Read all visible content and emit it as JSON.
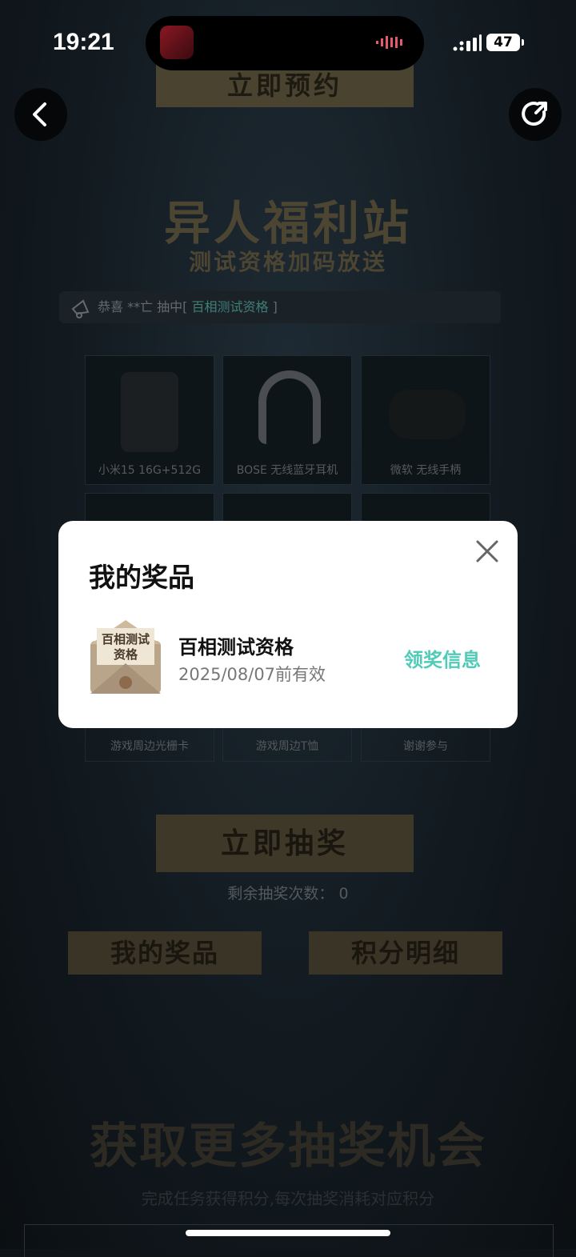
{
  "status_bar": {
    "time": "19:21",
    "battery": "47"
  },
  "page": {
    "top_button": "立即预约",
    "title": "异人福利站",
    "subtitle": "测试资格加码放送",
    "notice": {
      "prefix": "恭喜 **亡 抽中[",
      "prize": "百相测试资格",
      "suffix": "]"
    },
    "grid": [
      {
        "label": "小米15 16G+512G"
      },
      {
        "label": "BOSE 无线蓝牙耳机"
      },
      {
        "label": "微软 无线手柄"
      },
      {
        "label": "游戏周边光栅卡"
      },
      {
        "label": "游戏周边T恤"
      },
      {
        "label": "谢谢参与"
      }
    ],
    "draw_button": "立即抽奖",
    "remaining": "剩余抽奖次数： 0",
    "my_prizes_button": "我的奖品",
    "points_button": "积分明细",
    "more_title": "获取更多抽奖机会",
    "more_subtitle": "完成任务获得积分,每次抽奖消耗对应积分"
  },
  "modal": {
    "title": "我的奖品",
    "prize_name": "百相测试资格",
    "prize_expiry": "2025/08/07前有效",
    "claim_link": "领奖信息",
    "envelope_text_1": "百相测试",
    "envelope_text_2": "资格"
  },
  "icons": {
    "back": "chevron-left-icon",
    "share": "share-icon",
    "close": "close-icon",
    "notice": "megaphone-icon"
  },
  "colors": {
    "accent": "#4fcbb8",
    "gold_dim": "#4c4532"
  }
}
